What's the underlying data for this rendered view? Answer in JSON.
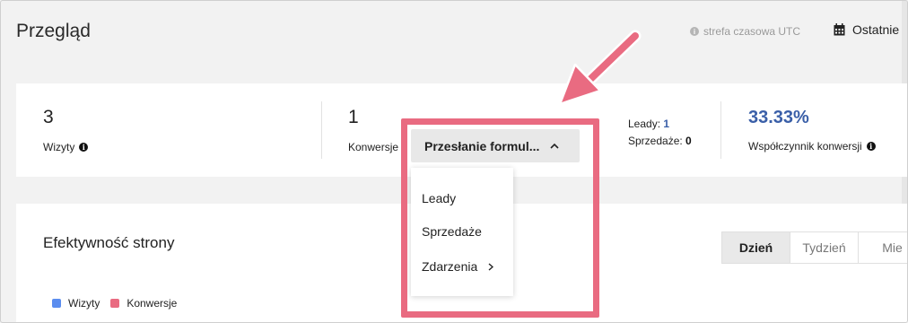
{
  "header": {
    "title": "Przegląd",
    "timezone_note": "strefa czasowa UTC",
    "range_label": "Ostatnie"
  },
  "stats": {
    "visits": {
      "value": "3",
      "label": "Wizyty"
    },
    "conversions": {
      "value": "1",
      "label": "Konwersje"
    },
    "breakdown": {
      "leads_label": "Leady:",
      "leads_value": "1",
      "sales_label": "Sprzedaże:",
      "sales_value": "0"
    },
    "conversion_rate": {
      "value": "33.33%",
      "label": "Współczynnik konwersji"
    }
  },
  "dropdown": {
    "button_label": "Przesłanie formul...",
    "items": [
      "Leady",
      "Sprzedaże",
      "Zdarzenia"
    ]
  },
  "performance": {
    "title": "Efektywność strony",
    "tabs": [
      "Dzień",
      "Tydzień",
      "Mie"
    ],
    "active_tab": "Dzień",
    "legend": [
      {
        "label": "Wizyty",
        "color": "#5b8def"
      },
      {
        "label": "Konwersje",
        "color": "#e96b81"
      }
    ]
  },
  "colors": {
    "accent": "#3a5fa8",
    "highlight": "#e96b81"
  }
}
